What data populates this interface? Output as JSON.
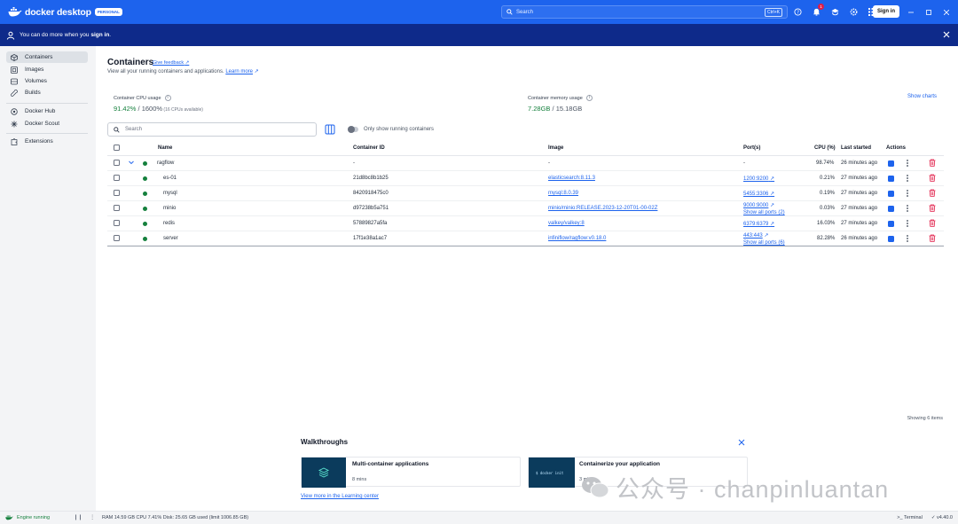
{
  "app": {
    "brand": "docker desktop",
    "badge": "PERSONAL",
    "search_placeholder": "Search",
    "search_shortcut": "Ctrl+K",
    "notification_count": "1",
    "sign_in_label": "Sign in"
  },
  "banner": {
    "text_prefix": "You can do more when you ",
    "text_bold": "sign in",
    "text_suffix": "."
  },
  "sidebar": {
    "items": [
      {
        "label": "Containers",
        "icon": "container-icon"
      },
      {
        "label": "Images",
        "icon": "image-icon"
      },
      {
        "label": "Volumes",
        "icon": "volume-icon"
      },
      {
        "label": "Builds",
        "icon": "wrench-icon"
      },
      {
        "label": "Docker Hub",
        "icon": "hub-icon"
      },
      {
        "label": "Docker Scout",
        "icon": "scout-icon"
      },
      {
        "label": "Extensions",
        "icon": "extensions-icon"
      }
    ]
  },
  "main": {
    "title": "Containers",
    "feedback": "Give feedback",
    "subtitle": "View all your running containers and applications. ",
    "learn_more": "Learn more",
    "cpu": {
      "label": "Container CPU usage",
      "value": "91.42%",
      "total": " / 1600%",
      "note": " (16 CPUs available)"
    },
    "memory": {
      "label": "Container memory usage",
      "value": "7.28GB",
      "total": " / 15.18GB"
    },
    "show_charts": "Show charts",
    "search_placeholder": "Search",
    "toggle_label": "Only show running containers",
    "columns": {
      "name": "Name",
      "container_id": "Container ID",
      "image": "Image",
      "ports": "Port(s)",
      "cpu": "CPU (%)",
      "last_started": "Last started",
      "actions": "Actions"
    },
    "rows": [
      {
        "name": "ragflow",
        "id": "-",
        "image": "-",
        "port": "-",
        "port2": "",
        "cpu": "98.74%",
        "started": "26 minutes ago"
      },
      {
        "name": "es-01",
        "id": "21d8bc8b1b25",
        "image": "elasticsearch:8.11.3",
        "port": "1200:9200",
        "port2": "",
        "cpu": "0.21%",
        "started": "27 minutes ago"
      },
      {
        "name": "mysql",
        "id": "8420918475c0",
        "image": "mysql:8.0.39",
        "port": "5455:3306",
        "port2": "",
        "cpu": "0.19%",
        "started": "27 minutes ago"
      },
      {
        "name": "minio",
        "id": "d97238b5a751",
        "image": "minio/minio:RELEASE.2023-12-20T01-00-02Z",
        "port": "9000:9000",
        "port2": "Show all ports (2)",
        "cpu": "0.03%",
        "started": "27 minutes ago"
      },
      {
        "name": "redis",
        "id": "57889827a5fa",
        "image": "valkey/valkey:8",
        "port": "6379:6379",
        "port2": "",
        "cpu": "16.03%",
        "started": "27 minutes ago"
      },
      {
        "name": "server",
        "id": "17f1e38a1ac7",
        "image": "infiniflow/ragflow:v0.18.0",
        "port": "443:443",
        "port2": "Show all ports (6)",
        "cpu": "82.28%",
        "started": "26 minutes ago"
      }
    ],
    "showing": "Showing 6 items"
  },
  "walkthroughs": {
    "title": "Walkthroughs",
    "cards": [
      {
        "title": "Multi-container applications",
        "sub": "8 mins"
      },
      {
        "title": "Containerize your application",
        "sub": "3 mins",
        "thumb_text": "$ docker init"
      }
    ],
    "learning_link": "View more in the Learning center"
  },
  "watermark": "公众号 · chanpinluantan",
  "statusbar": {
    "engine": "Engine running",
    "stats": "RAM 14.59 GB  CPU 7.41%   Disk: 25.65 GB used (limit 1006.85 GB)",
    "terminal": "Terminal",
    "version": "v4.40.0"
  },
  "colors": {
    "brand": "#1d63ed",
    "banner": "#0e2a8a",
    "running": "#15803d",
    "danger": "#e11d48"
  }
}
